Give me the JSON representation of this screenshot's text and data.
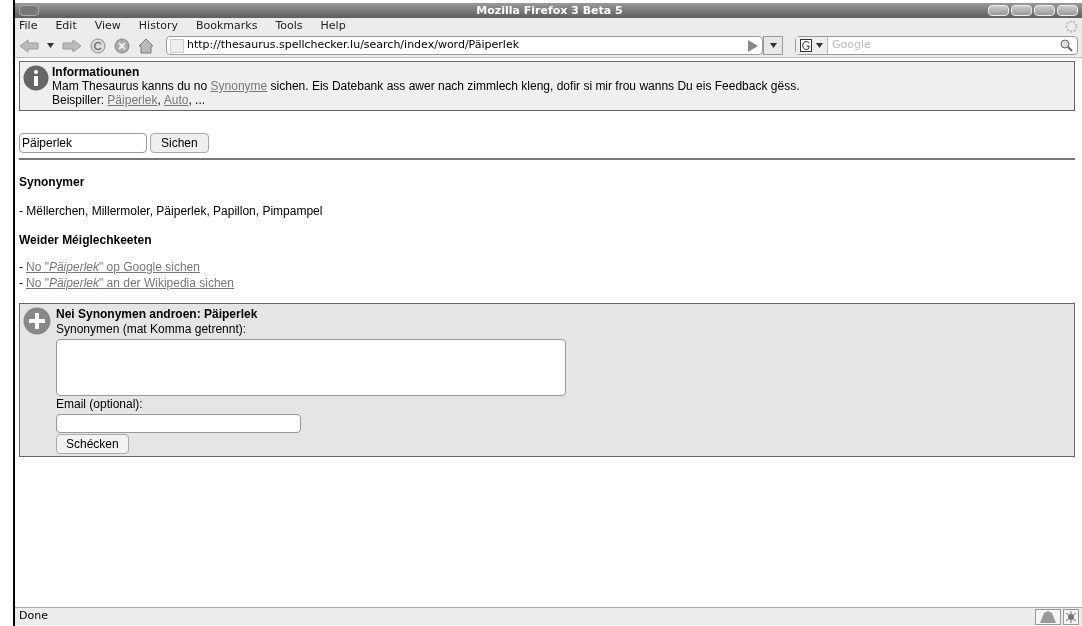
{
  "window": {
    "title": "Mozilla Firefox 3 Beta 5"
  },
  "menu": [
    "File",
    "Edit",
    "View",
    "History",
    "Bookmarks",
    "Tools",
    "Help"
  ],
  "toolbar": {
    "url": "http://thesaurus.spellchecker.lu/search/index/word/Päiperlek",
    "search_placeholder": "Google"
  },
  "info": {
    "title": "Informatiounen",
    "before": "Mam Thesaurus kanns du no ",
    "link": "Synonyme",
    "after": " sichen. Eis Datebank ass awer nach zimmlech kleng, dofir si mir frou wanns Du eis Feedback gëss.",
    "examples_label": "Beispiller: ",
    "examples": [
      "Päiperlek",
      "Auto"
    ],
    "examples_separator": ",",
    "examples_more": ", ..."
  },
  "search": {
    "value": "Päiperlek",
    "button": "Sichen"
  },
  "synonyms": {
    "heading": "Synonymer",
    "list": "- Mëllerchen, Millermoler, Päiperlek, Papillon, Pimpampel"
  },
  "more": {
    "heading": "Weider Méiglechkeeten",
    "bullet": "-",
    "links": [
      "No \"*Päiperlek*\" op Google sichen",
      "No \"*Päiperlek*\" an der Wikipedia sichen"
    ]
  },
  "add": {
    "title": "Nei Synonymen androen: Päiperlek",
    "synonyms_label": "Synonymen (mat Komma getrennt):",
    "email_label": "Email (optional):",
    "button": "Schécken"
  },
  "status_bar": {
    "text": "Done"
  }
}
